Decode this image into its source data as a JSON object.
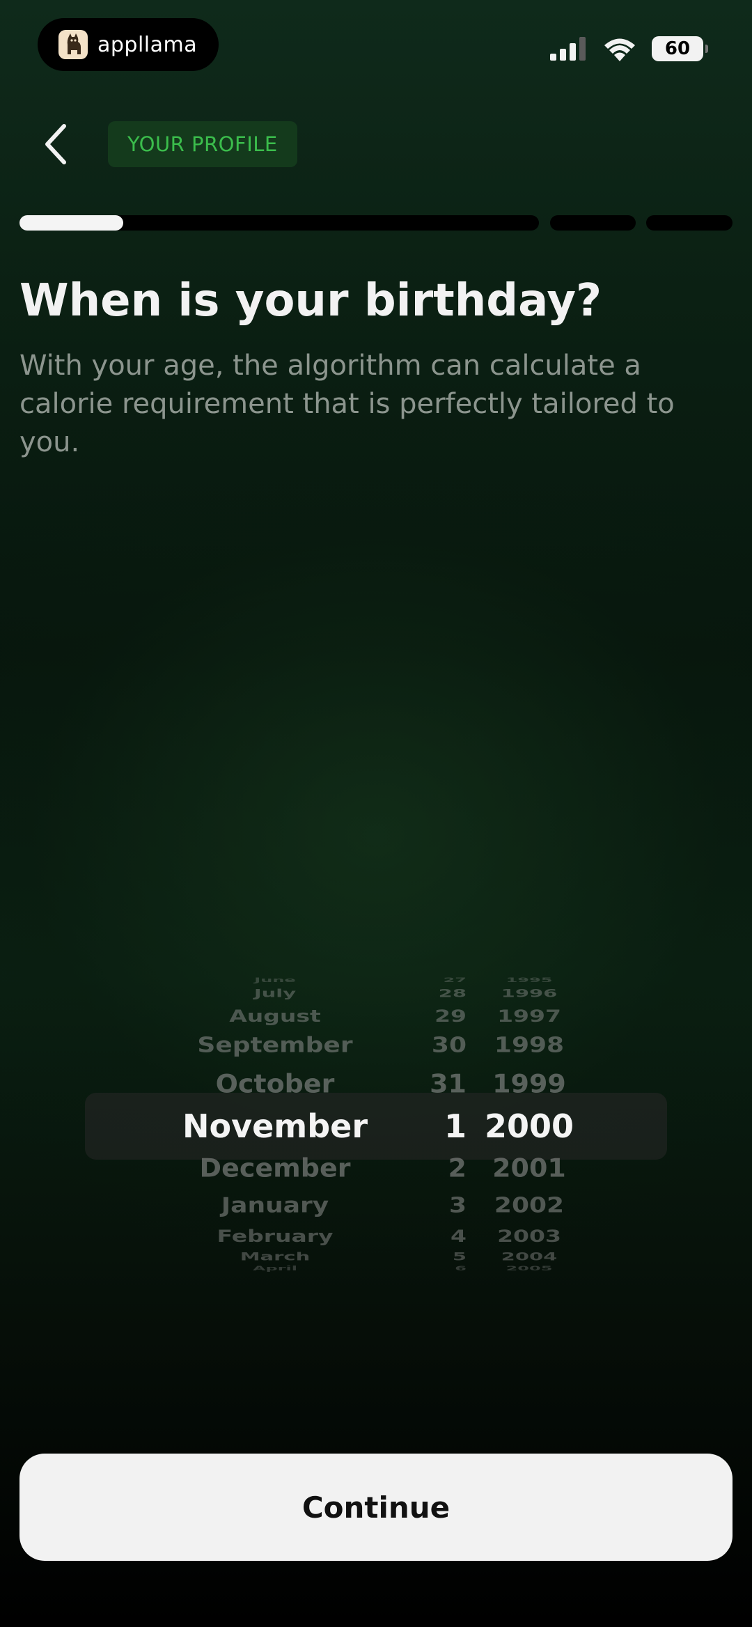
{
  "status_bar": {
    "app_name": "appllama",
    "app_icon": "llama-icon",
    "battery": "60",
    "signal_icon": "cellular-signal-icon",
    "wifi_icon": "wifi-icon"
  },
  "header": {
    "back_icon": "chevron-left-icon",
    "badge": "YOUR PROFILE"
  },
  "progress": {
    "segments": 4,
    "active_segment": 1,
    "active_fraction": 0.2
  },
  "content": {
    "title": "When is your birthday?",
    "subtitle": "With your age, the algorithm can calculate a calorie requirement that is perfectly tailored to you."
  },
  "picker": {
    "months": [
      "June",
      "July",
      "August",
      "September",
      "October",
      "November",
      "December",
      "January",
      "February",
      "March",
      "April"
    ],
    "days": [
      "27",
      "28",
      "29",
      "30",
      "31",
      "1",
      "2",
      "3",
      "4",
      "5",
      "6"
    ],
    "years": [
      "1995",
      "1996",
      "1997",
      "1998",
      "1999",
      "2000",
      "2001",
      "2002",
      "2003",
      "2004",
      "2005"
    ],
    "selected_index": 5,
    "selected": {
      "month": "November",
      "day": "1",
      "year": "2000"
    }
  },
  "colors": {
    "accent_green": "#3bbd4c",
    "badge_bg": "#143a1c",
    "button_bg": "#f2f2f2"
  },
  "actions": {
    "continue_label": "Continue"
  }
}
